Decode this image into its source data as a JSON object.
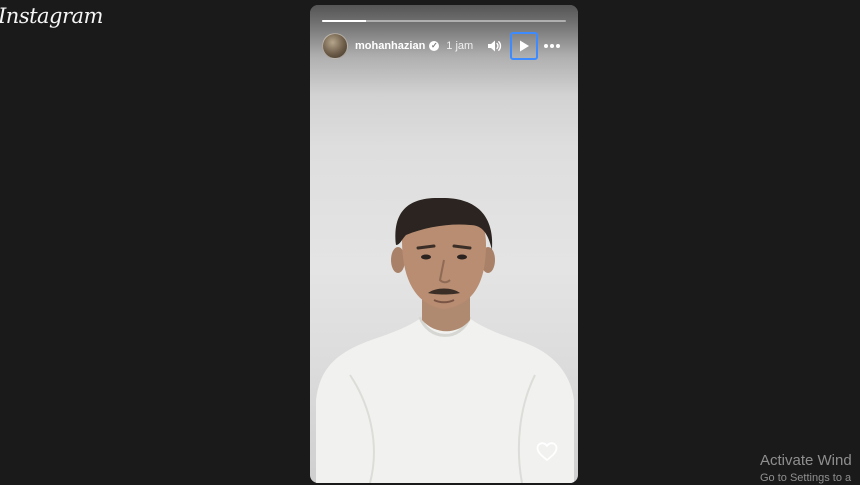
{
  "app": {
    "logo_text": "Instagram"
  },
  "story": {
    "progress": 0.18,
    "username": "mohanhazian",
    "verified": true,
    "time": "1 jam",
    "controls": {
      "mute_icon": "volume-icon",
      "play_icon": "play-icon",
      "more_icon": "more-options-icon"
    },
    "like_icon": "heart-icon"
  },
  "os_watermark": {
    "title": "Activate Wind",
    "subtitle": "Go to Settings to a"
  },
  "colors": {
    "background": "#1a1a1a",
    "focus_ring": "#3d8bff",
    "white": "#ffffff"
  }
}
